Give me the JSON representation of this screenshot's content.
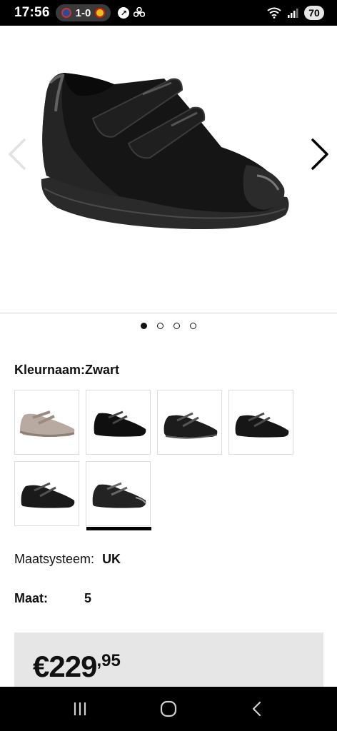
{
  "status_bar": {
    "time": "17:56",
    "score": "1-0",
    "battery": "70",
    "icons": [
      "psg-crest-icon",
      "lens-crest-icon",
      "notification-icon",
      "fan-icon",
      "wifi-icon",
      "signal-icon"
    ]
  },
  "gallery": {
    "prev_icon": "chevron-left-icon",
    "next_icon": "chevron-right-icon",
    "image_count": 4,
    "active_index": 0
  },
  "color": {
    "label": "Kleurnaam:",
    "value": "Zwart",
    "swatch_count": 6,
    "selected_index": 5,
    "swatch_colors": [
      "#b8aaa0",
      "#0f0f0f",
      "#1c1c1c",
      "#161616",
      "#1a1a1a",
      "#232323"
    ]
  },
  "size_system": {
    "label": "Maatsysteem:",
    "value": "UK"
  },
  "size": {
    "label": "Maat:",
    "value": "5"
  },
  "price": {
    "main": "€229",
    "cents": ",95"
  },
  "android_nav": {
    "icons": [
      "recent-apps-icon",
      "home-icon",
      "back-icon"
    ]
  }
}
